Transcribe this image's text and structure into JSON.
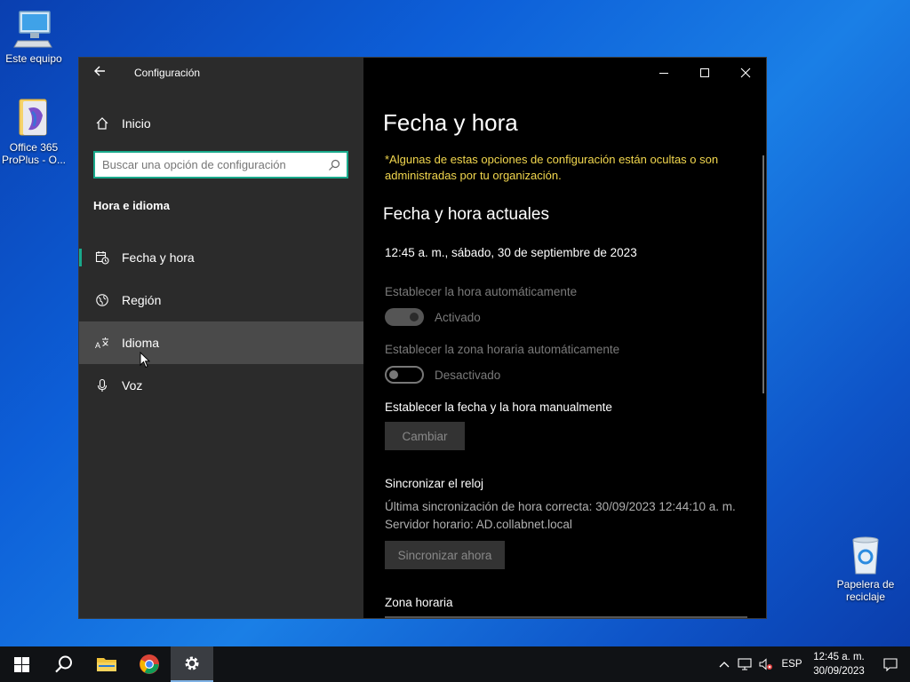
{
  "desktop": {
    "icons": [
      {
        "label": "Este equipo",
        "icon": "computer-icon"
      },
      {
        "label": "Office 365 ProPlus - O...",
        "icon": "office-folder-icon"
      },
      {
        "label": "Papelera de reciclaje",
        "icon": "recycle-bin-icon"
      }
    ]
  },
  "window": {
    "app_title": "Configuración",
    "home_label": "Inicio",
    "search_placeholder": "Buscar una opción de configuración",
    "section_title": "Hora e idioma",
    "nav_items": [
      {
        "label": "Fecha y hora",
        "icon": "calendar-clock-icon",
        "active": true
      },
      {
        "label": "Región",
        "icon": "globe-icon"
      },
      {
        "label": "Idioma",
        "icon": "language-icon",
        "hover": true
      },
      {
        "label": "Voz",
        "icon": "microphone-icon"
      }
    ],
    "page_title": "Fecha y hora",
    "notice": "*Algunas de estas opciones de configuración están ocultas o son administradas por tu organización.",
    "current_heading": "Fecha y hora actuales",
    "current_value": "12:45 a. m., sábado, 30 de septiembre de 2023",
    "auto_time": {
      "label": "Establecer la hora automáticamente",
      "state": "Activado",
      "on": true
    },
    "auto_zone": {
      "label": "Establecer la zona horaria automáticamente",
      "state": "Desactivado",
      "on": false
    },
    "manual": {
      "label": "Establecer la fecha y la hora manualmente",
      "button": "Cambiar"
    },
    "sync": {
      "heading": "Sincronizar el reloj",
      "last_sync": "Última sincronización de hora correcta: 30/09/2023 12:44:10 a. m.",
      "server": "Servidor horario: AD.collabnet.local",
      "button": "Sincronizar ahora"
    },
    "timezone_heading": "Zona horaria"
  },
  "taskbar": {
    "language": "ESP",
    "time": "12:45 a. m.",
    "date": "30/09/2023"
  },
  "colors": {
    "accent": "#19a98b",
    "notice": "#f2d74e",
    "sidebar_bg": "#2b2b2b"
  }
}
